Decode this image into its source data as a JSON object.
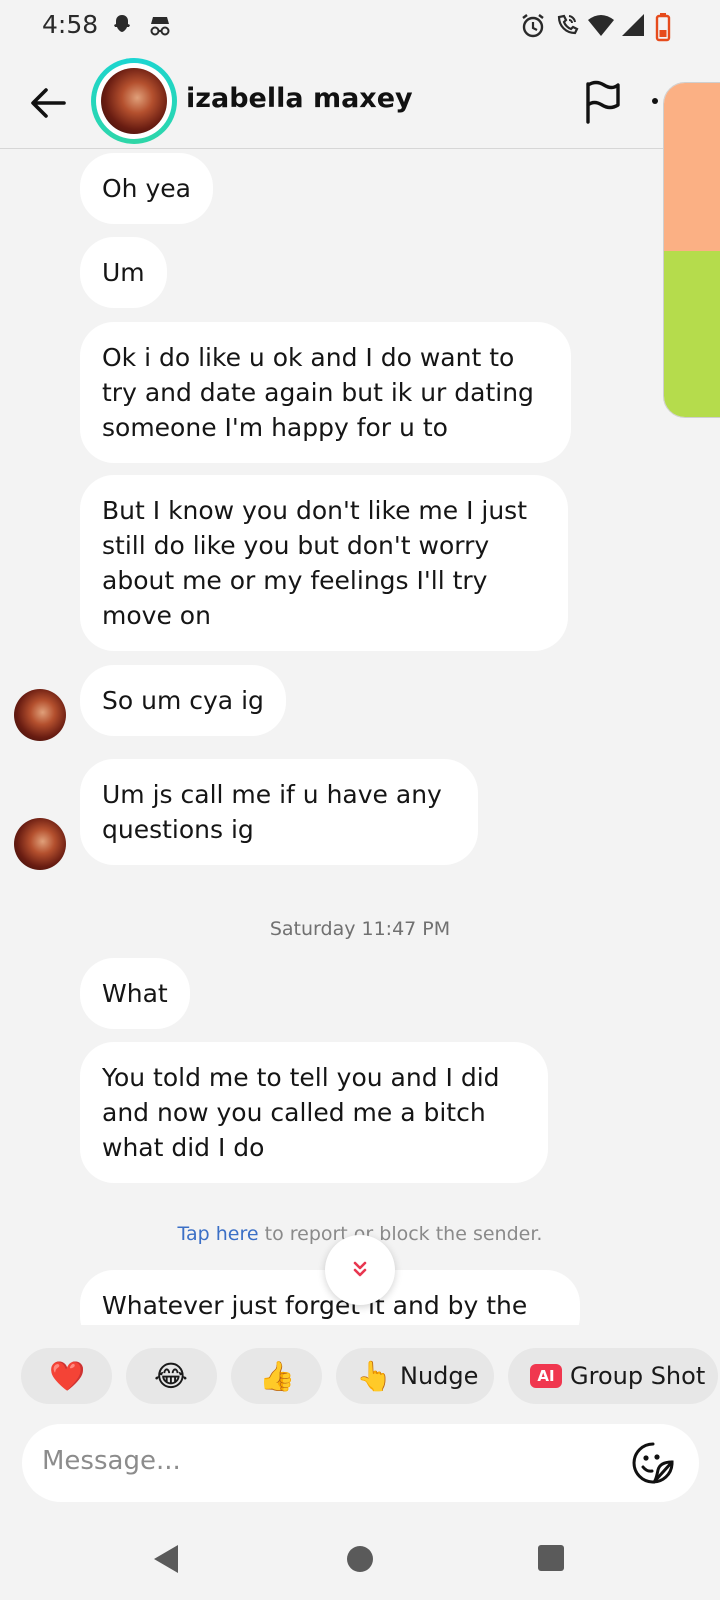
{
  "status_bar": {
    "time": "4:58",
    "left_icons": [
      "snapchat-ghost-icon",
      "incognito-icon"
    ],
    "right_icons": [
      "alarm-icon",
      "wifi-calling-icon",
      "wifi-icon",
      "cell-signal-icon",
      "battery-low-icon"
    ]
  },
  "header": {
    "contact_name": "izabella maxey",
    "back_icon": "arrow-left-icon",
    "flag_icon": "flag-icon"
  },
  "messages": [
    {
      "text": "Oh yea"
    },
    {
      "text": "Um"
    },
    {
      "text": "Ok i do like u ok and I do want to try and date again but ik ur dating someone I'm happy for u to"
    },
    {
      "text": "But I know you don't like me I just still do like you but don't worry about me or my feelings I'll try move on"
    },
    {
      "text": "So um cya ig"
    },
    {
      "text": "Um js call me if u have any questions ig"
    },
    {
      "text": "What"
    },
    {
      "text": "You told me to tell you and I did and now you called me a bitch what did I do"
    },
    {
      "text": "Whatever just forget it and by the"
    }
  ],
  "timestamp": "Saturday 11:47 PM",
  "report": {
    "link_text": "Tap here",
    "rest_text": " to report or block the sender."
  },
  "scroll_down_icon": "double-chevron-down-icon",
  "quick_replies": [
    {
      "emoji": "❤️",
      "label": ""
    },
    {
      "emoji": "😂",
      "label": ""
    },
    {
      "emoji": "👍",
      "label": ""
    },
    {
      "emoji": "👆",
      "label": "Nudge"
    },
    {
      "emoji": "AI",
      "label": "Group Shot"
    }
  ],
  "composer": {
    "placeholder": "Message...",
    "sticker_icon": "sticker-smile-icon"
  },
  "nav": {
    "back_icon": "nav-back-triangle-icon",
    "home_icon": "nav-home-circle-icon",
    "recents_icon": "nav-recents-square-icon"
  },
  "colors": {
    "background": "#f3f3f3",
    "bubble": "#ffffff",
    "link": "#3b6fc6",
    "avatar_ring": "#1bd5d3",
    "ai_badge": "#f0374f",
    "scroll_chevron": "#e8364f"
  }
}
